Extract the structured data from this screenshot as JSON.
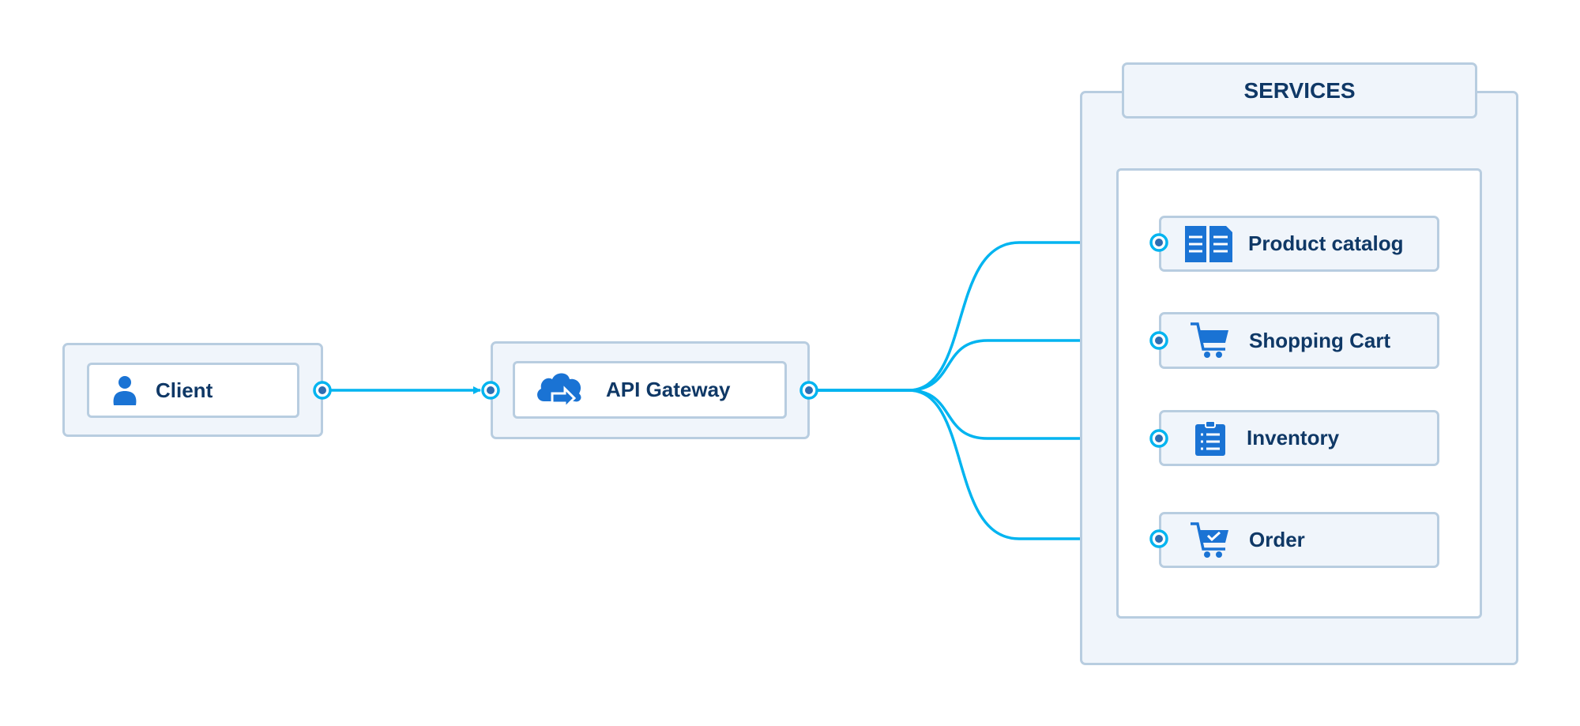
{
  "colors": {
    "connector": "#00b4f0",
    "border": "#b8cde0",
    "fill": "#f0f5fb",
    "text": "#0f3866",
    "icon": "#1a73d4",
    "port_dot": "#2f6db0"
  },
  "client": {
    "label": "Client",
    "icon": "user-icon"
  },
  "gateway": {
    "label": "API Gateway",
    "icon": "cloud-forward-icon"
  },
  "services": {
    "title": "SERVICES",
    "items": [
      {
        "label": "Product catalog",
        "icon": "documents-icon"
      },
      {
        "label": "Shopping Cart",
        "icon": "cart-icon"
      },
      {
        "label": "Inventory",
        "icon": "clipboard-list-icon"
      },
      {
        "label": "Order",
        "icon": "cart-check-icon"
      }
    ]
  }
}
